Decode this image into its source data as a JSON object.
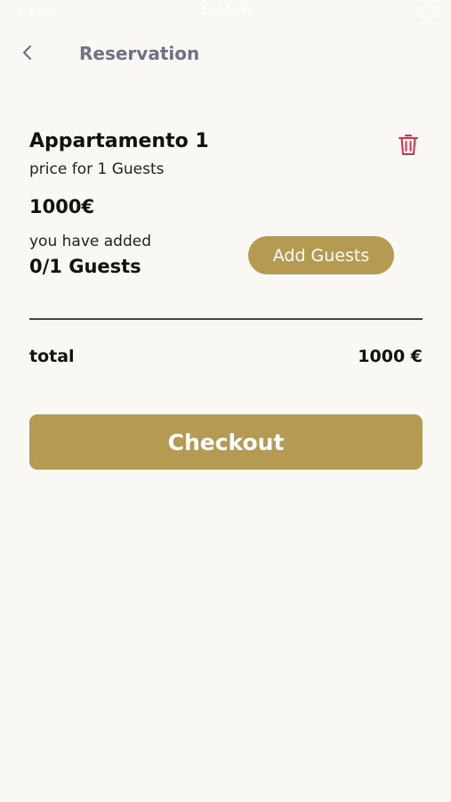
{
  "status_bar": {
    "carrier": "Carrier",
    "time": "12:19 PM"
  },
  "header": {
    "title": "Reservation",
    "back_icon": "chevron-left-icon"
  },
  "item": {
    "name": "Appartamento 1",
    "subtitle": "price for 1 Guests",
    "price": "1000€",
    "added_label": "you have added",
    "guest_count": "0/1 Guests",
    "add_guests_label": "Add Guests",
    "delete_icon": "trash-icon"
  },
  "summary": {
    "total_label": "total",
    "total_value": "1000 €"
  },
  "checkout": {
    "label": "Checkout"
  },
  "colors": {
    "accent": "#b59a52",
    "background": "#f9f8f4",
    "delete": "#d9304a",
    "title": "#6c7480"
  }
}
